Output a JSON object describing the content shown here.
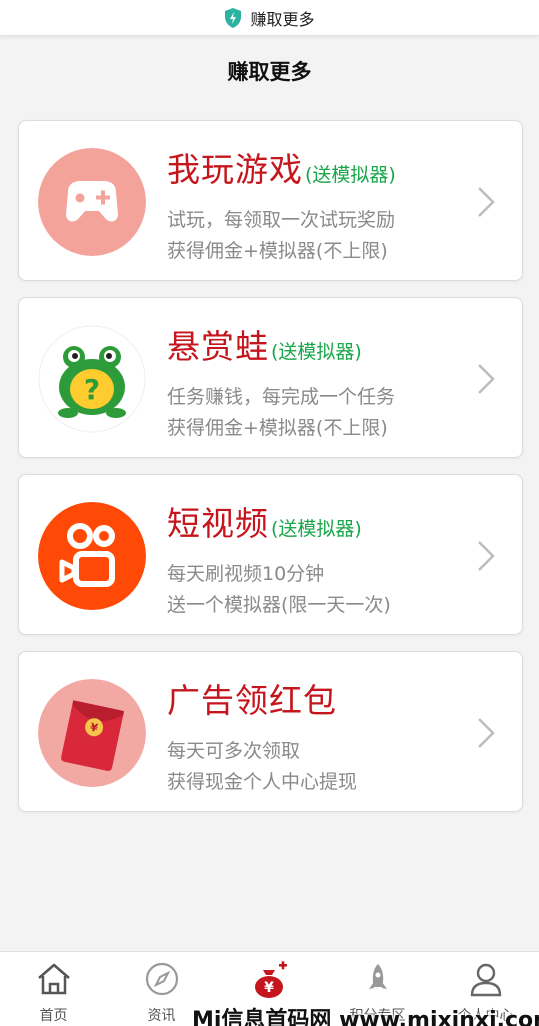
{
  "status_bar": {
    "title": "赚取更多",
    "icon": "shield-icon"
  },
  "page": {
    "title": "赚取更多"
  },
  "cards": [
    {
      "title": "我玩游戏",
      "tag": "(送模拟器)",
      "desc1": "试玩，每领取一次试玩奖励",
      "desc2": "获得佣金+模拟器(不上限)",
      "icon": "gamepad-icon"
    },
    {
      "title": "悬赏蛙",
      "tag": "(送模拟器)",
      "desc1": "任务赚钱，每完成一个任务",
      "desc2": "获得佣金+模拟器(不上限)",
      "icon": "frog-icon"
    },
    {
      "title": "短视频",
      "tag": "(送模拟器)",
      "desc1": "每天刷视频10分钟",
      "desc2": "送一个模拟器(限一天一次)",
      "icon": "video-camera-icon"
    },
    {
      "title": "广告领红包",
      "tag": "",
      "desc1": "每天可多次领取",
      "desc2": "获得现金个人中心提现",
      "icon": "red-envelope-icon"
    }
  ],
  "nav": [
    {
      "label": "首页",
      "icon": "home-icon"
    },
    {
      "label": "资讯",
      "icon": "compass-icon"
    },
    {
      "label": "",
      "icon": "money-bag-icon"
    },
    {
      "label": "积分专区",
      "icon": "rocket-icon"
    },
    {
      "label": "个人中心",
      "icon": "user-icon"
    }
  ],
  "watermark": "Mi信息首码网 www.mixinxi.com",
  "colors": {
    "title_red": "#c4161c",
    "tag_green": "#1aa64a",
    "desc_gray": "#8a8a8a"
  }
}
